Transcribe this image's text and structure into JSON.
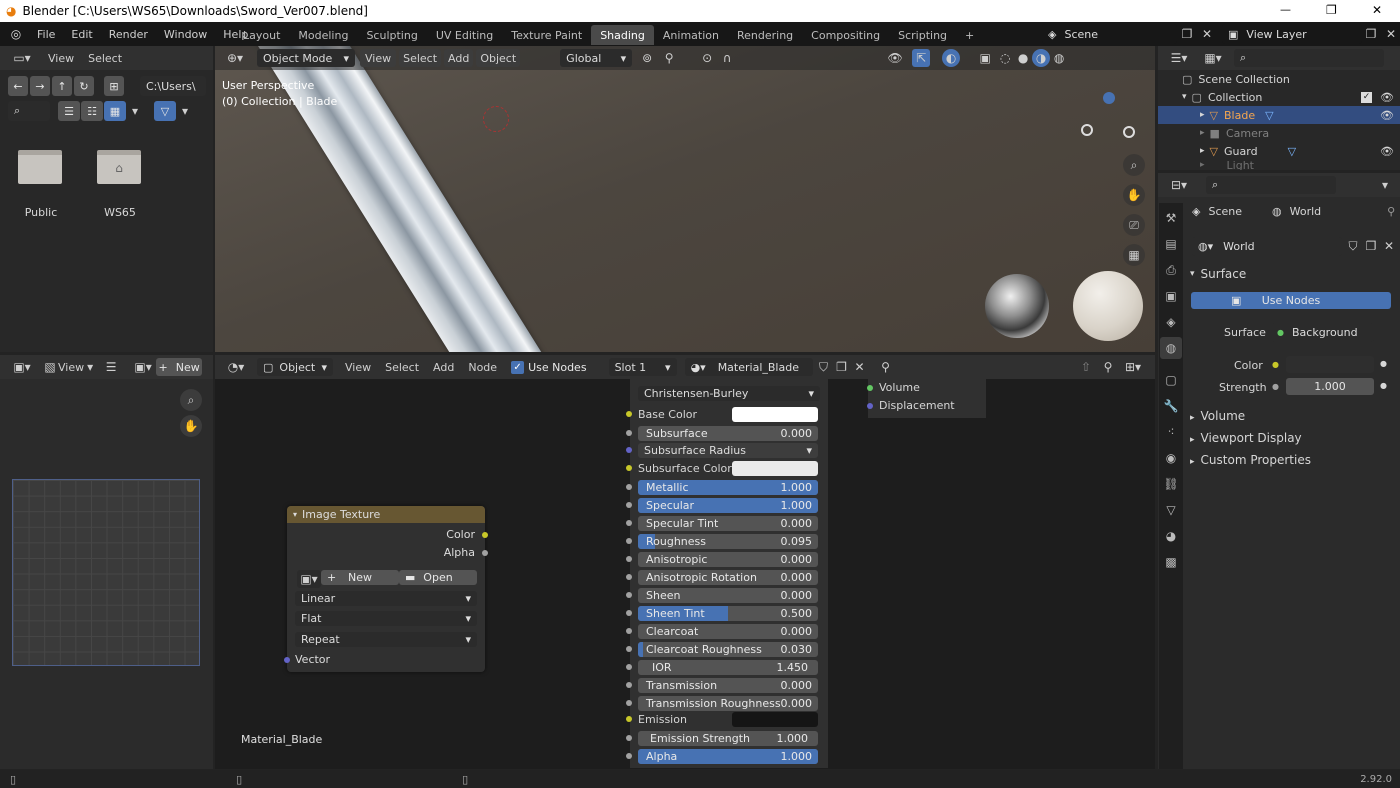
{
  "window": {
    "title": "Blender [C:\\Users\\WS65\\Downloads\\Sword_Ver007.blend]",
    "min": "—",
    "max": "❐",
    "close": "✕"
  },
  "menu": {
    "items": [
      "File",
      "Edit",
      "Render",
      "Window",
      "Help"
    ]
  },
  "workspaces": {
    "tabs": [
      "Layout",
      "Modeling",
      "Sculpting",
      "UV Editing",
      "Texture Paint",
      "Shading",
      "Animation",
      "Rendering",
      "Compositing",
      "Scripting"
    ],
    "active": "Shading",
    "add": "+"
  },
  "scene": {
    "name": "Scene",
    "view_layer": "View Layer"
  },
  "filebrowser": {
    "view": "View",
    "select": "Select",
    "path": "C:\\Users\\",
    "folders": [
      "Public",
      "WS65"
    ]
  },
  "viewport": {
    "mode": "Object Mode",
    "view": "View",
    "select": "Select",
    "add": "Add",
    "object": "Object",
    "orientation": "Global",
    "label_line1": "User Perspective",
    "label_line2": "(0) Collection | Blade"
  },
  "outliner": {
    "scene_collection": "Scene Collection",
    "collection": "Collection",
    "items": [
      "Blade",
      "Camera",
      "Guard",
      "Light"
    ]
  },
  "properties": {
    "scene_tab": "Scene",
    "world_tab": "World",
    "world_name": "World",
    "surface": "Surface",
    "use_nodes": "Use Nodes",
    "surface_label": "Surface",
    "surface_value": "Background",
    "color_label": "Color",
    "strength_label": "Strength",
    "strength_value": "1.000",
    "sections": [
      "Volume",
      "Viewport Display",
      "Custom Properties"
    ]
  },
  "imageeditor": {
    "view": "View",
    "new": "New"
  },
  "nodeeditor": {
    "object": "Object",
    "view": "View",
    "select": "Select",
    "add": "Add",
    "node": "Node",
    "use_nodes": "Use Nodes",
    "slot": "Slot 1",
    "material": "Material_Blade",
    "material_label": "Material_Blade"
  },
  "image_texture": {
    "title": "Image Texture",
    "out_color": "Color",
    "out_alpha": "Alpha",
    "new": "New",
    "open": "Open",
    "interpolation": "Linear",
    "projection": "Flat",
    "extension": "Repeat",
    "vector": "Vector"
  },
  "bsdf": {
    "subsurface_method": "Christensen-Burley",
    "base_color": "Base Color",
    "subsurface_radius": "Subsurface Radius",
    "subsurface_color": "Subsurface Color",
    "emission": "Emission",
    "sliders": [
      {
        "label": "Subsurface",
        "value": "0.000",
        "fill": 0
      },
      {
        "label": "Metallic",
        "value": "1.000",
        "fill": 1
      },
      {
        "label": "Specular",
        "value": "1.000",
        "fill": 1
      },
      {
        "label": "Specular Tint",
        "value": "0.000",
        "fill": 0
      },
      {
        "label": "Roughness",
        "value": "0.095",
        "fill": 0.095
      },
      {
        "label": "Anisotropic",
        "value": "0.000",
        "fill": 0
      },
      {
        "label": "Anisotropic Rotation",
        "value": "0.000",
        "fill": 0
      },
      {
        "label": "Sheen",
        "value": "0.000",
        "fill": 0
      },
      {
        "label": "Sheen Tint",
        "value": "0.500",
        "fill": 0.5
      },
      {
        "label": "Clearcoat",
        "value": "0.000",
        "fill": 0
      },
      {
        "label": "Clearcoat Roughness",
        "value": "0.030",
        "fill": 0.03
      },
      {
        "label": "IOR",
        "value": "1.450",
        "fill": 0
      },
      {
        "label": "Transmission",
        "value": "0.000",
        "fill": 0
      },
      {
        "label": "Transmission Roughness",
        "value": "0.000",
        "fill": 0
      },
      {
        "label": "Emission Strength",
        "value": "1.000",
        "fill": 0
      },
      {
        "label": "Alpha",
        "value": "1.000",
        "fill": 1
      }
    ]
  },
  "output_node": {
    "volume": "Volume",
    "displacement": "Displacement"
  },
  "status": {
    "version": "2.92.0"
  }
}
